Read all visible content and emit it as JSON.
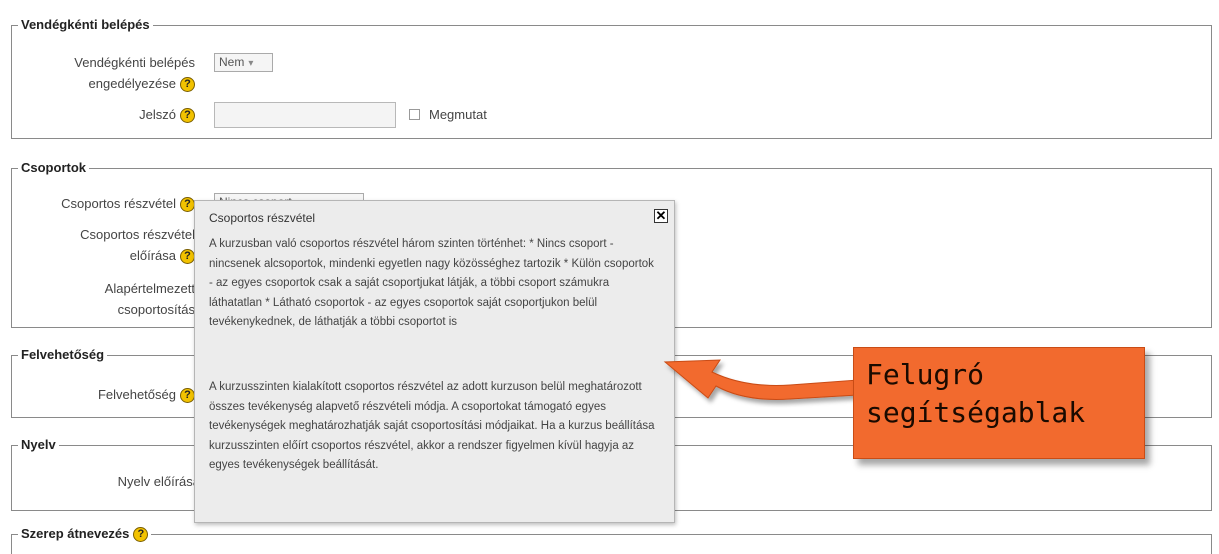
{
  "guest": {
    "legend": "Vendégkénti belépés",
    "allow_label_1": "Vendégkénti belépés",
    "allow_label_2": "engedélyezése",
    "allow_value": "Nem",
    "password_label": "Jelszó",
    "show_label": "Megmutat"
  },
  "groups": {
    "legend": "Csoportok",
    "mode_label": "Csoportos részvétel",
    "mode_value": "Nincs csoport",
    "force_label_1": "Csoportos részvétel",
    "force_label_2": "előírása",
    "default_label_1": "Alapértelmezett",
    "default_label_2": "csoportosítás"
  },
  "availability": {
    "legend": "Felvehetőség",
    "label": "Felvehetőség"
  },
  "language": {
    "legend": "Nyelv",
    "label": "Nyelv előírása"
  },
  "next_section": {
    "legend": "Szerep átnevezés"
  },
  "help_icon": "?",
  "popup": {
    "title": "Csoportos részvétel",
    "close": "✕",
    "paragraph1": "A kurzusban való csoportos részvétel három szinten történhet: * Nincs csoport - nincsenek alcsoportok, mindenki egyetlen nagy közösséghez tartozik * Külön csoportok - az egyes csoportok csak a saját csoportjukat látják, a többi csoport számukra láthatatlan * Látható csoportok - az egyes csoportok saját csoportjukon belül tevékenykednek, de láthatják a többi csoportot is",
    "paragraph2": "A kurzusszinten kialakított csoportos részvétel az adott kurzuson belül meghatározott összes tevékenység alapvető részvételi módja. A csoportokat támogató egyes tevékenységek meghatározhatják saját csoportosítási módjaikat. Ha a kurzus beállítása kurzusszinten előírt csoportos részvétel, akkor a rendszer figyelmen kívül hagyja az egyes tevékenységek beállítását."
  },
  "callout": {
    "line1": "Felugró",
    "line2": "segítségablak"
  }
}
